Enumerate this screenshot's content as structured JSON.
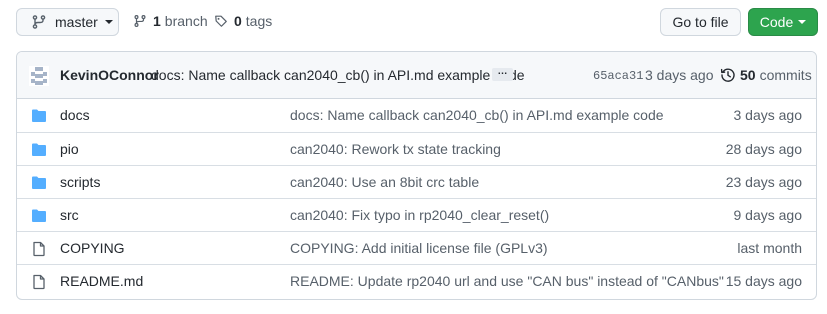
{
  "toolbar": {
    "branch_name": "master",
    "branches_count": "1",
    "branches_label": "branch",
    "tags_count": "0",
    "tags_label": "tags",
    "goto_file_label": "Go to file",
    "code_label": "Code"
  },
  "latest_commit": {
    "author": "KevinOConnor",
    "message": "docs: Name callback can2040_cb() in API.md example code",
    "ellipsis": "…",
    "sha": "65aca31",
    "date": "3 days ago",
    "commits_count": "50",
    "commits_label": "commits"
  },
  "files": [
    {
      "type": "folder",
      "name": "docs",
      "message": "docs: Name callback can2040_cb() in API.md example code",
      "date": "3 days ago"
    },
    {
      "type": "folder",
      "name": "pio",
      "message": "can2040: Rework tx state tracking",
      "date": "28 days ago"
    },
    {
      "type": "folder",
      "name": "scripts",
      "message": "can2040: Use an 8bit crc table",
      "date": "23 days ago"
    },
    {
      "type": "folder",
      "name": "src",
      "message": "can2040: Fix typo in rp2040_clear_reset()",
      "date": "9 days ago"
    },
    {
      "type": "file",
      "name": "COPYING",
      "message": "COPYING: Add initial license file (GPLv3)",
      "date": "last month"
    },
    {
      "type": "file",
      "name": "README.md",
      "message": "README: Update rp2040 url and use \"CAN bus\" instead of \"CANbus\"",
      "date": "15 days ago"
    }
  ],
  "colors": {
    "folder_icon": "#54aeff",
    "code_button": "#2da44e",
    "muted_text": "#57606a"
  }
}
